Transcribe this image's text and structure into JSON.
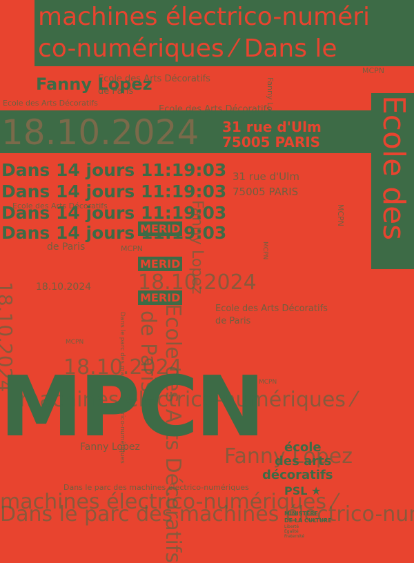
{
  "colors": {
    "background": "#E8442F",
    "ink": "#3D6B46"
  },
  "top_band": {
    "line1": "machines électrico-numéri",
    "line2": "co-numériques ⁄ Dans le"
  },
  "author": "Fanny Lopez",
  "school": {
    "name": "Ecole des Arts Décoratifs",
    "city": "de Paris"
  },
  "date": "18.10.2024",
  "address": {
    "street": "31 rue d'Ulm",
    "city": "75005 PARIS"
  },
  "side_band": "Ecole des",
  "countdown": "Dans 14 jours 11:19:03",
  "tag": "MERID",
  "abbr": "MCPN",
  "title": "MPCN",
  "tagline": "machines électrico-numériques ⁄",
  "tagline2": "Dans le parc des machines électrico-numériques",
  "brand": {
    "l1": "école",
    "l2": "des arts",
    "l3": "décoratifs",
    "psl": "PSL ★",
    "ministry1": "MINISTÈRE",
    "ministry2": "DE LA CULTURE",
    "ministry_small": "Liberté Égalité Fraternité"
  }
}
